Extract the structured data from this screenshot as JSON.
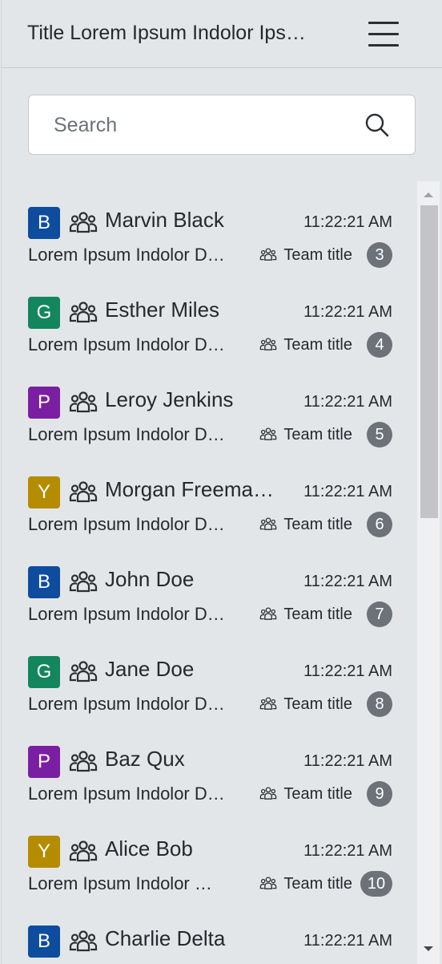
{
  "header": {
    "title": "Title Lorem Ipsum Indolor Ips…"
  },
  "search": {
    "placeholder": "Search"
  },
  "colors": {
    "blue": "#0e4c9e",
    "green": "#14865d",
    "purple": "#7b1fa2",
    "yellow": "#b58c00",
    "badge": "#6c7278"
  },
  "items": [
    {
      "initial": "B",
      "color": "#0e4c9e",
      "name": "Marvin Black",
      "time": "11:22:21 AM",
      "preview": "Lorem Ipsum Indolor D…",
      "team": "Team title",
      "count": "3"
    },
    {
      "initial": "G",
      "color": "#14865d",
      "name": "Esther Miles",
      "time": "11:22:21 AM",
      "preview": "Lorem Ipsum Indolor D…",
      "team": "Team title",
      "count": "4"
    },
    {
      "initial": "P",
      "color": "#7b1fa2",
      "name": "Leroy Jenkins",
      "time": "11:22:21 AM",
      "preview": "Lorem Ipsum Indolor D…",
      "team": "Team title",
      "count": "5"
    },
    {
      "initial": "Y",
      "color": "#b58c00",
      "name": "Morgan Freema…",
      "time": "11:22:21 AM",
      "preview": "Lorem Ipsum Indolor D…",
      "team": "Team title",
      "count": "6"
    },
    {
      "initial": "B",
      "color": "#0e4c9e",
      "name": "John Doe",
      "time": "11:22:21 AM",
      "preview": "Lorem Ipsum Indolor D…",
      "team": "Team title",
      "count": "7"
    },
    {
      "initial": "G",
      "color": "#14865d",
      "name": "Jane Doe",
      "time": "11:22:21 AM",
      "preview": "Lorem Ipsum Indolor D…",
      "team": "Team title",
      "count": "8"
    },
    {
      "initial": "P",
      "color": "#7b1fa2",
      "name": "Baz Qux",
      "time": "11:22:21 AM",
      "preview": "Lorem Ipsum Indolor D…",
      "team": "Team title",
      "count": "9"
    },
    {
      "initial": "Y",
      "color": "#b58c00",
      "name": "Alice Bob",
      "time": "11:22:21 AM",
      "preview": "Lorem Ipsum Indolor …",
      "team": "Team title",
      "count": "10"
    },
    {
      "initial": "B",
      "color": "#0e4c9e",
      "name": "Charlie Delta",
      "time": "11:22:21 AM",
      "preview": "",
      "team": "",
      "count": ""
    }
  ]
}
